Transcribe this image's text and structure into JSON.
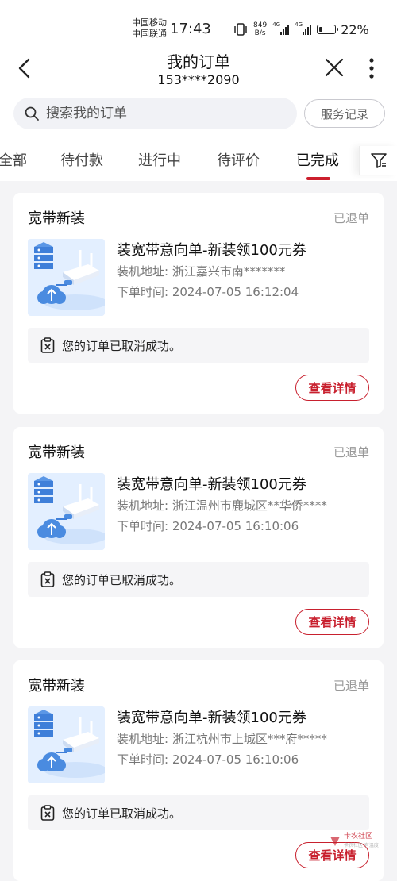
{
  "status_bar": {
    "carrier1": "中国移动",
    "carrier2": "中国联通",
    "time": "17:43",
    "net_speed_value": "849",
    "net_speed_unit": "B/s",
    "sig_tag_1": "4G",
    "sig_tag_2": "4G",
    "battery": "22%",
    "battery_level": 0.22
  },
  "header": {
    "title": "我的订单",
    "phone": "153****2090"
  },
  "search": {
    "placeholder": "搜索我的订单",
    "service_label": "服务记录"
  },
  "tabs": [
    {
      "label": "全部"
    },
    {
      "label": "待付款"
    },
    {
      "label": "进行中"
    },
    {
      "label": "待评价"
    },
    {
      "label": "已完成",
      "active": true
    }
  ],
  "orders": [
    {
      "type": "宽带新装",
      "status": "已退单",
      "title": "装宽带意向单-新装领100元券",
      "address": "装机地址:  浙江嘉兴市南*******",
      "time": "下单时间:  2024-07-05 16:12:04",
      "notice": "您的订单已取消成功。",
      "button": "查看详情"
    },
    {
      "type": "宽带新装",
      "status": "已退单",
      "title": "装宽带意向单-新装领100元券",
      "address": "装机地址:  浙江温州市鹿城区**华侨****",
      "time": "下单时间:  2024-07-05 16:10:06",
      "notice": "您的订单已取消成功。",
      "button": "查看详情"
    },
    {
      "type": "宽带新装",
      "status": "已退单",
      "title": "装宽带意向单-新装领100元券",
      "address": "装机地址:  浙江杭州市上城区***府*****",
      "time": "下单时间:  2024-07-05 16:10:06",
      "notice": "您的订单已取消成功。",
      "button": "查看详情"
    }
  ],
  "watermark": {
    "text": "卡农社区",
    "sub": "卡农社区 有温度"
  },
  "colors": {
    "accent": "#c8202e",
    "background": "#f4f4f6",
    "card": "#ffffff"
  }
}
